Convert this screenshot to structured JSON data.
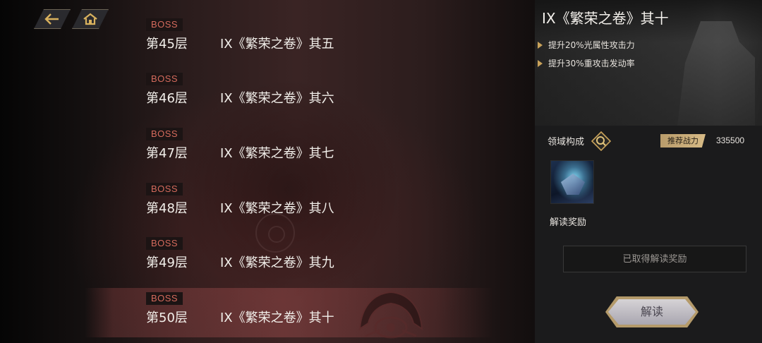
{
  "nav": {
    "back_icon": "back-arrow-icon",
    "home_icon": "home-icon"
  },
  "floors": [
    {
      "badge": "BOSS",
      "floor": "第45层",
      "name": "IX《繁荣之卷》其五"
    },
    {
      "badge": "BOSS",
      "floor": "第46层",
      "name": "IX《繁荣之卷》其六"
    },
    {
      "badge": "BOSS",
      "floor": "第47层",
      "name": "IX《繁荣之卷》其七"
    },
    {
      "badge": "BOSS",
      "floor": "第48层",
      "name": "IX《繁荣之卷》其八"
    },
    {
      "badge": "BOSS",
      "floor": "第49层",
      "name": "IX《繁荣之卷》其九"
    },
    {
      "badge": "BOSS",
      "floor": "第50层",
      "name": "IX《繁荣之卷》其十"
    }
  ],
  "selected_floor_index": 5,
  "panel": {
    "title": "IX《繁荣之卷》其十",
    "buffs": [
      "提升20%光属性攻击力",
      "提升30%重攻击发动率"
    ],
    "domain_label": "领域构成",
    "power_label": "推荐战力",
    "power_value": "335500",
    "reward_label": "解读奖励",
    "claimed_text": "已取得解读奖励",
    "decode_button": "解读"
  },
  "colors": {
    "boss_text": "#d46a5c",
    "accent_gold": "#c9a25a",
    "selected_row": "#a04e4e"
  }
}
